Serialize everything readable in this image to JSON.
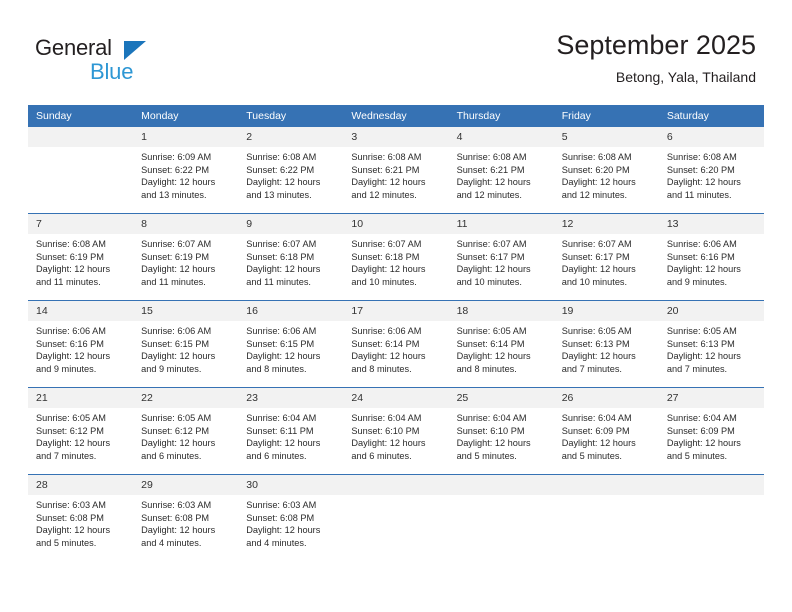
{
  "brand": {
    "word_one": "General",
    "word_two": "Blue",
    "triangle_color": "#1b75bb",
    "blue_color": "#2e97d4"
  },
  "header": {
    "month_title": "September 2025",
    "location": "Betong, Yala, Thailand"
  },
  "theme": {
    "header_blue": "#3672b4",
    "daynum_band": "#f2f2f2",
    "text": "#2b2b2b"
  },
  "calendar": {
    "weekday_headers": [
      "Sunday",
      "Monday",
      "Tuesday",
      "Wednesday",
      "Thursday",
      "Friday",
      "Saturday"
    ],
    "weeks": [
      [
        {
          "day": "",
          "sunrise": "",
          "sunset": "",
          "daylight_1": "",
          "daylight_2": "",
          "empty": true
        },
        {
          "day": "1",
          "sunrise": "Sunrise: 6:09 AM",
          "sunset": "Sunset: 6:22 PM",
          "daylight_1": "Daylight: 12 hours",
          "daylight_2": "and 13 minutes."
        },
        {
          "day": "2",
          "sunrise": "Sunrise: 6:08 AM",
          "sunset": "Sunset: 6:22 PM",
          "daylight_1": "Daylight: 12 hours",
          "daylight_2": "and 13 minutes."
        },
        {
          "day": "3",
          "sunrise": "Sunrise: 6:08 AM",
          "sunset": "Sunset: 6:21 PM",
          "daylight_1": "Daylight: 12 hours",
          "daylight_2": "and 12 minutes."
        },
        {
          "day": "4",
          "sunrise": "Sunrise: 6:08 AM",
          "sunset": "Sunset: 6:21 PM",
          "daylight_1": "Daylight: 12 hours",
          "daylight_2": "and 12 minutes."
        },
        {
          "day": "5",
          "sunrise": "Sunrise: 6:08 AM",
          "sunset": "Sunset: 6:20 PM",
          "daylight_1": "Daylight: 12 hours",
          "daylight_2": "and 12 minutes."
        },
        {
          "day": "6",
          "sunrise": "Sunrise: 6:08 AM",
          "sunset": "Sunset: 6:20 PM",
          "daylight_1": "Daylight: 12 hours",
          "daylight_2": "and 11 minutes."
        }
      ],
      [
        {
          "day": "7",
          "sunrise": "Sunrise: 6:08 AM",
          "sunset": "Sunset: 6:19 PM",
          "daylight_1": "Daylight: 12 hours",
          "daylight_2": "and 11 minutes."
        },
        {
          "day": "8",
          "sunrise": "Sunrise: 6:07 AM",
          "sunset": "Sunset: 6:19 PM",
          "daylight_1": "Daylight: 12 hours",
          "daylight_2": "and 11 minutes."
        },
        {
          "day": "9",
          "sunrise": "Sunrise: 6:07 AM",
          "sunset": "Sunset: 6:18 PM",
          "daylight_1": "Daylight: 12 hours",
          "daylight_2": "and 11 minutes."
        },
        {
          "day": "10",
          "sunrise": "Sunrise: 6:07 AM",
          "sunset": "Sunset: 6:18 PM",
          "daylight_1": "Daylight: 12 hours",
          "daylight_2": "and 10 minutes."
        },
        {
          "day": "11",
          "sunrise": "Sunrise: 6:07 AM",
          "sunset": "Sunset: 6:17 PM",
          "daylight_1": "Daylight: 12 hours",
          "daylight_2": "and 10 minutes."
        },
        {
          "day": "12",
          "sunrise": "Sunrise: 6:07 AM",
          "sunset": "Sunset: 6:17 PM",
          "daylight_1": "Daylight: 12 hours",
          "daylight_2": "and 10 minutes."
        },
        {
          "day": "13",
          "sunrise": "Sunrise: 6:06 AM",
          "sunset": "Sunset: 6:16 PM",
          "daylight_1": "Daylight: 12 hours",
          "daylight_2": "and 9 minutes."
        }
      ],
      [
        {
          "day": "14",
          "sunrise": "Sunrise: 6:06 AM",
          "sunset": "Sunset: 6:16 PM",
          "daylight_1": "Daylight: 12 hours",
          "daylight_2": "and 9 minutes."
        },
        {
          "day": "15",
          "sunrise": "Sunrise: 6:06 AM",
          "sunset": "Sunset: 6:15 PM",
          "daylight_1": "Daylight: 12 hours",
          "daylight_2": "and 9 minutes."
        },
        {
          "day": "16",
          "sunrise": "Sunrise: 6:06 AM",
          "sunset": "Sunset: 6:15 PM",
          "daylight_1": "Daylight: 12 hours",
          "daylight_2": "and 8 minutes."
        },
        {
          "day": "17",
          "sunrise": "Sunrise: 6:06 AM",
          "sunset": "Sunset: 6:14 PM",
          "daylight_1": "Daylight: 12 hours",
          "daylight_2": "and 8 minutes."
        },
        {
          "day": "18",
          "sunrise": "Sunrise: 6:05 AM",
          "sunset": "Sunset: 6:14 PM",
          "daylight_1": "Daylight: 12 hours",
          "daylight_2": "and 8 minutes."
        },
        {
          "day": "19",
          "sunrise": "Sunrise: 6:05 AM",
          "sunset": "Sunset: 6:13 PM",
          "daylight_1": "Daylight: 12 hours",
          "daylight_2": "and 7 minutes."
        },
        {
          "day": "20",
          "sunrise": "Sunrise: 6:05 AM",
          "sunset": "Sunset: 6:13 PM",
          "daylight_1": "Daylight: 12 hours",
          "daylight_2": "and 7 minutes."
        }
      ],
      [
        {
          "day": "21",
          "sunrise": "Sunrise: 6:05 AM",
          "sunset": "Sunset: 6:12 PM",
          "daylight_1": "Daylight: 12 hours",
          "daylight_2": "and 7 minutes."
        },
        {
          "day": "22",
          "sunrise": "Sunrise: 6:05 AM",
          "sunset": "Sunset: 6:12 PM",
          "daylight_1": "Daylight: 12 hours",
          "daylight_2": "and 6 minutes."
        },
        {
          "day": "23",
          "sunrise": "Sunrise: 6:04 AM",
          "sunset": "Sunset: 6:11 PM",
          "daylight_1": "Daylight: 12 hours",
          "daylight_2": "and 6 minutes."
        },
        {
          "day": "24",
          "sunrise": "Sunrise: 6:04 AM",
          "sunset": "Sunset: 6:10 PM",
          "daylight_1": "Daylight: 12 hours",
          "daylight_2": "and 6 minutes."
        },
        {
          "day": "25",
          "sunrise": "Sunrise: 6:04 AM",
          "sunset": "Sunset: 6:10 PM",
          "daylight_1": "Daylight: 12 hours",
          "daylight_2": "and 5 minutes."
        },
        {
          "day": "26",
          "sunrise": "Sunrise: 6:04 AM",
          "sunset": "Sunset: 6:09 PM",
          "daylight_1": "Daylight: 12 hours",
          "daylight_2": "and 5 minutes."
        },
        {
          "day": "27",
          "sunrise": "Sunrise: 6:04 AM",
          "sunset": "Sunset: 6:09 PM",
          "daylight_1": "Daylight: 12 hours",
          "daylight_2": "and 5 minutes."
        }
      ],
      [
        {
          "day": "28",
          "sunrise": "Sunrise: 6:03 AM",
          "sunset": "Sunset: 6:08 PM",
          "daylight_1": "Daylight: 12 hours",
          "daylight_2": "and 5 minutes."
        },
        {
          "day": "29",
          "sunrise": "Sunrise: 6:03 AM",
          "sunset": "Sunset: 6:08 PM",
          "daylight_1": "Daylight: 12 hours",
          "daylight_2": "and 4 minutes."
        },
        {
          "day": "30",
          "sunrise": "Sunrise: 6:03 AM",
          "sunset": "Sunset: 6:08 PM",
          "daylight_1": "Daylight: 12 hours",
          "daylight_2": "and 4 minutes."
        },
        {
          "day": "",
          "sunrise": "",
          "sunset": "",
          "daylight_1": "",
          "daylight_2": "",
          "empty": true
        },
        {
          "day": "",
          "sunrise": "",
          "sunset": "",
          "daylight_1": "",
          "daylight_2": "",
          "empty": true
        },
        {
          "day": "",
          "sunrise": "",
          "sunset": "",
          "daylight_1": "",
          "daylight_2": "",
          "empty": true
        },
        {
          "day": "",
          "sunrise": "",
          "sunset": "",
          "daylight_1": "",
          "daylight_2": "",
          "empty": true
        }
      ]
    ]
  }
}
